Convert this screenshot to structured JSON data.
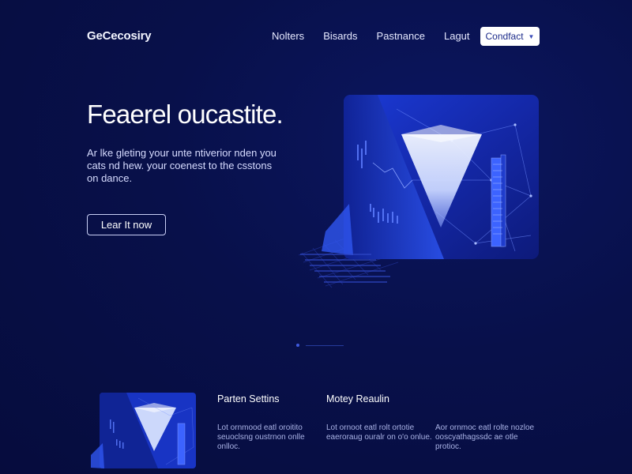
{
  "nav": {
    "logo": "GeCecosiry",
    "links": [
      "Nolters",
      "Bisards",
      "Pastnance",
      "Lagut"
    ],
    "contact_label": "Condfact"
  },
  "hero": {
    "title": "Feaerel oucastite.",
    "subtitle": "Ar lke gleting your unte ntiverior nden you cats nd hew. your coenest to the csstons on dance.",
    "cta_label": "Lear It now"
  },
  "features": [
    {
      "title": "Parten Settins",
      "text": "Lot ornmood eatl oroitito seuoclsng oustrnon onlle onlloc."
    },
    {
      "title": "Motey Reaulin",
      "text": "Lot ornoot eatl rolt ortotie eaeroraug ouralr on o'o onlue."
    },
    {
      "title": "",
      "text": "Aor ornmoc eatl rolte nozloe ooscyathagssdc ae otle protioc."
    }
  ],
  "colors": {
    "background": "#08104a",
    "accent": "#2f4fe6",
    "button_bg": "#ffffff"
  }
}
